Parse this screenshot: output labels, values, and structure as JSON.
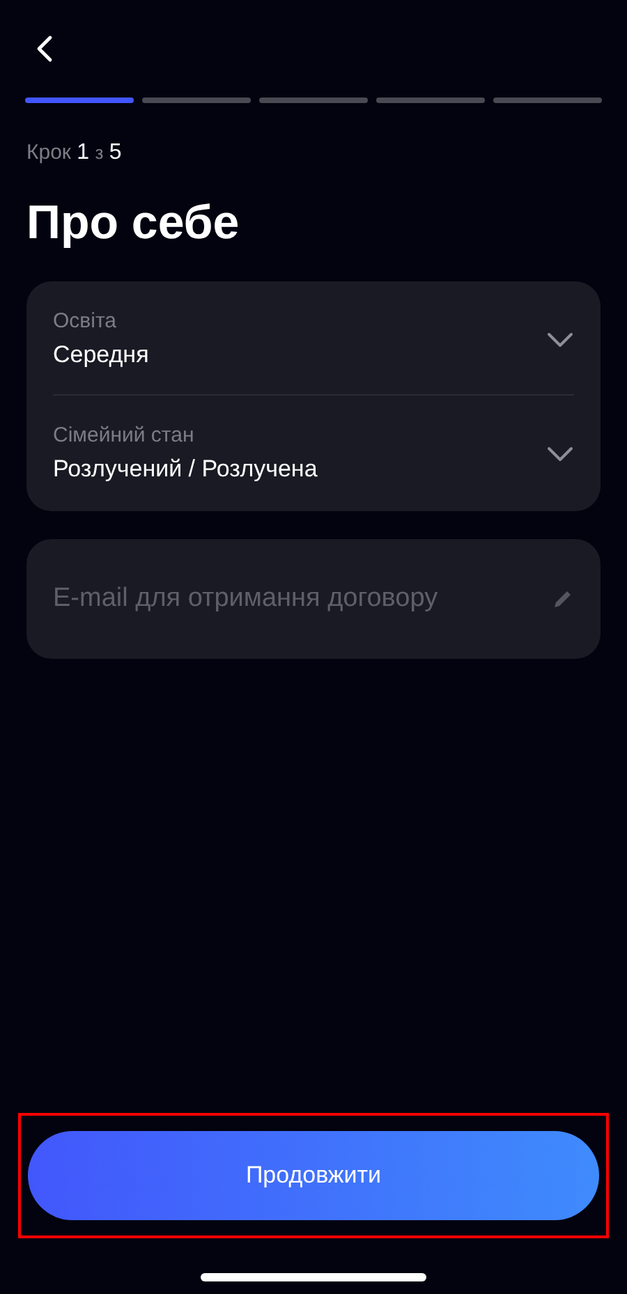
{
  "progress": [
    {
      "active": true
    },
    {
      "active": false
    },
    {
      "active": false
    },
    {
      "active": false
    },
    {
      "active": false
    }
  ],
  "step": {
    "label": "Крок",
    "current": "1",
    "separator": "з",
    "total": "5"
  },
  "title": "Про себе",
  "selects": [
    {
      "label": "Освіта",
      "value": "Середня"
    },
    {
      "label": "Сімейний стан",
      "value": "Розлучений / Розлучена"
    }
  ],
  "email_field": {
    "placeholder": "E-mail для отримання договору"
  },
  "continue_button": {
    "label": "Продовжити",
    "highlighted": true
  }
}
